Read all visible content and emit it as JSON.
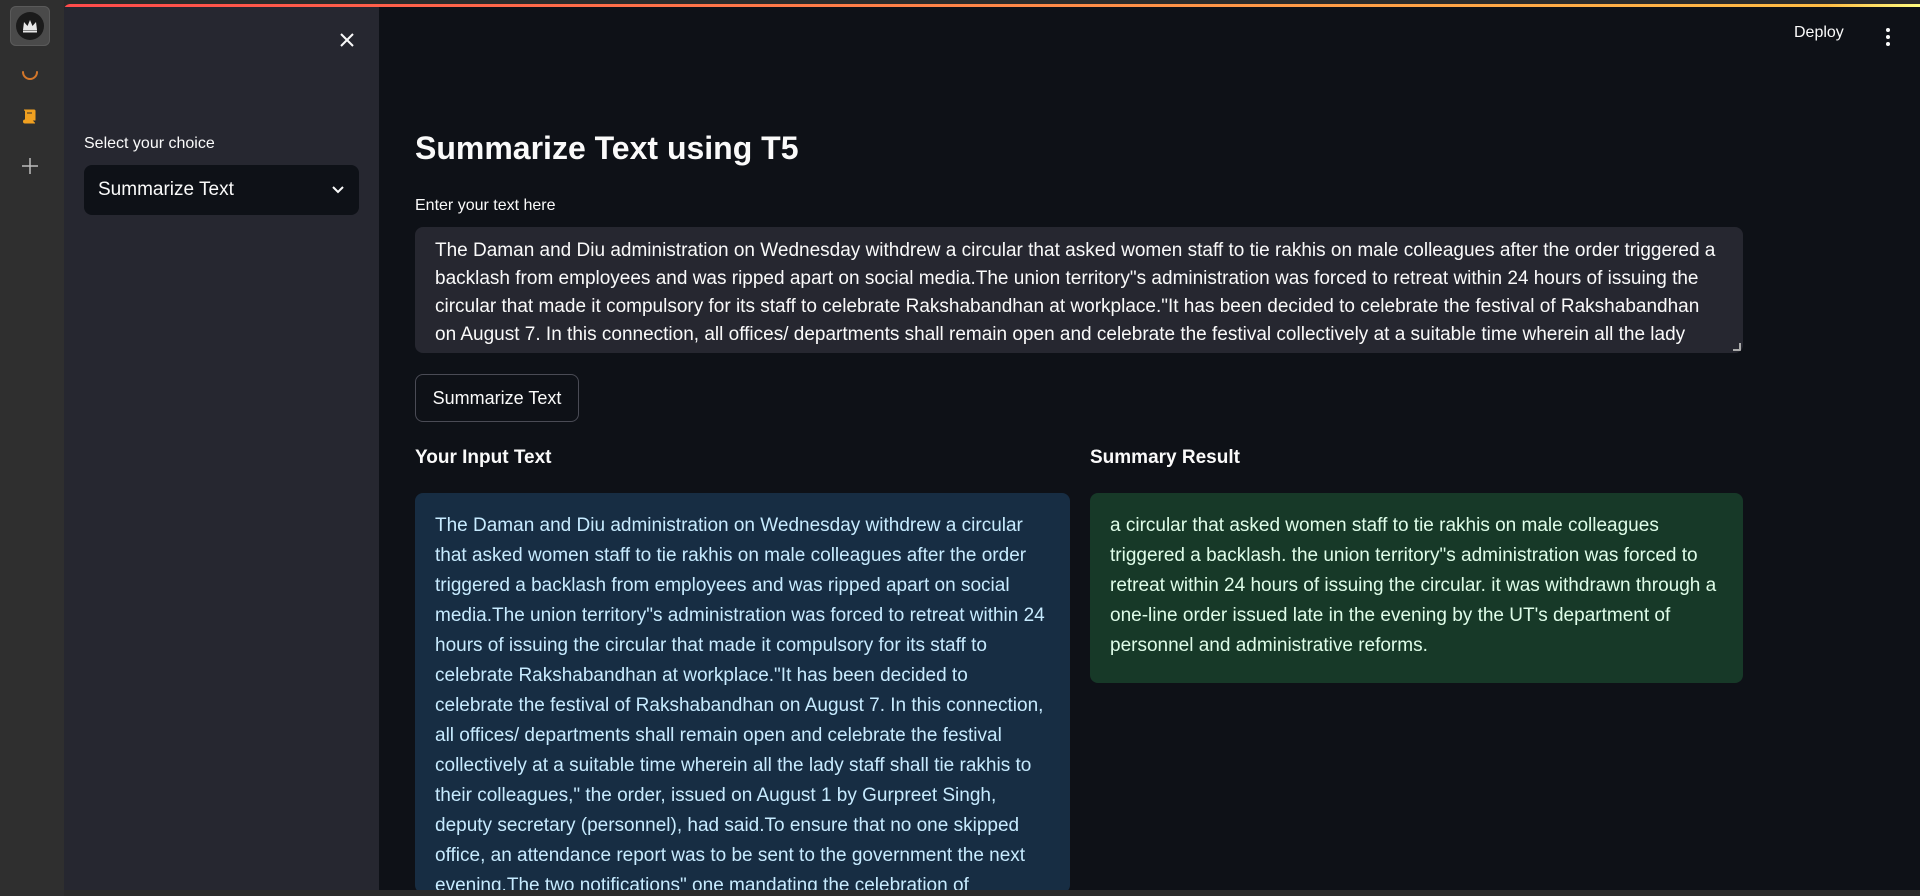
{
  "dock": {
    "icons": [
      "crown-logo-icon",
      "spinner-icon",
      "book-icon",
      "plus-icon"
    ]
  },
  "header": {
    "deploy_label": "Deploy"
  },
  "sidebar": {
    "select_label": "Select your choice",
    "select_value": "Summarize Text"
  },
  "main": {
    "title": "Summarize Text using T5",
    "input_label": "Enter your text here",
    "textarea_value": "The Daman and Diu administration on Wednesday withdrew a circular that asked women staff to tie rakhis on male colleagues after the order triggered a backlash from employees and was ripped apart on social media.The union territory\"s administration was forced to retreat within 24 hours of issuing the circular that made it compulsory for its staff to celebrate Rakshabandhan at workplace.\"It has been decided to celebrate the festival of Rakshabandhan on August 7. In this connection, all offices/ departments shall remain open and celebrate the festival collectively at a suitable time wherein all the lady staff",
    "button_label": "Summarize Text",
    "input_heading": "Your Input Text",
    "summary_heading": "Summary Result",
    "input_text": "The Daman and Diu administration on Wednesday withdrew a circular that asked women staff to tie rakhis on male colleagues after the order triggered a backlash from employees and was ripped apart on social media.The union territory\"s administration was forced to retreat within 24 hours of issuing the circular that made it compulsory for its staff to celebrate Rakshabandhan at workplace.\"It has been decided to celebrate the festival of Rakshabandhan on August 7. In this connection, all offices/ departments shall remain open and celebrate the festival collectively at a suitable time wherein all the lady staff shall tie rakhis to their colleagues,\" the order, issued on August 1 by Gurpreet Singh, deputy secretary (personnel), had said.To ensure that no one skipped office, an attendance report was to be sent to the government the next evening.The two notifications\" one mandating the celebration of Rakshabandhan (left)",
    "summary_text": "a circular that asked women staff to tie rakhis on male colleagues triggered a backlash. the union territory\"s administration was forced to retreat within 24 hours of issuing the circular. it was withdrawn through a one-line order issued late in the evening by the UT's department of personnel and administrative reforms."
  },
  "colors": {
    "background": "#0e1117",
    "sidebar": "#262730",
    "info_box": "#172d43",
    "success_box": "#173928",
    "accent_gradient_start": "#ff4b4b",
    "accent_gradient_end": "#fffd80"
  }
}
